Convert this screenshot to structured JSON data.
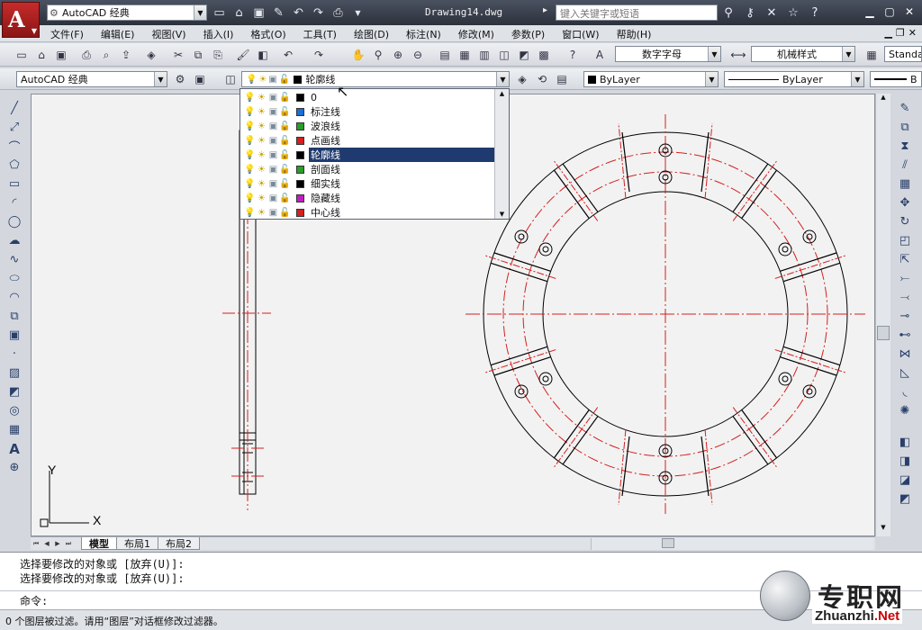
{
  "titlebar": {
    "logo_letter": "A",
    "workspace": "AutoCAD 经典",
    "document": "Drawing14.dwg",
    "search_placeholder": "键入关键字或短语"
  },
  "menu": [
    "文件(F)",
    "编辑(E)",
    "视图(V)",
    "插入(I)",
    "格式(O)",
    "工具(T)",
    "绘图(D)",
    "标注(N)",
    "修改(M)",
    "参数(P)",
    "窗口(W)",
    "帮助(H)"
  ],
  "styles": {
    "text_style": "数字字母",
    "dim_style": "机械样式",
    "table_style": "Standa"
  },
  "workspace_combo": "AutoCAD 经典",
  "layer": {
    "current": "轮廓线",
    "list": [
      {
        "name": "0",
        "color": "#000000"
      },
      {
        "name": "标注线",
        "color": "#1a6fd8"
      },
      {
        "name": "波浪线",
        "color": "#2a9d2a"
      },
      {
        "name": "点画线",
        "color": "#d42020"
      },
      {
        "name": "轮廓线",
        "color": "#000000",
        "selected": true
      },
      {
        "name": "剖面线",
        "color": "#2a9d2a"
      },
      {
        "name": "细实线",
        "color": "#000000"
      },
      {
        "name": "隐藏线",
        "color": "#c21fc2"
      },
      {
        "name": "中心线",
        "color": "#d42020"
      }
    ]
  },
  "properties": {
    "color": "ByLayer",
    "linetype": "ByLayer",
    "lineweight": "B"
  },
  "layout_tabs": [
    "模型",
    "布局1",
    "布局2"
  ],
  "ucs": {
    "x": "X",
    "y": "Y"
  },
  "command": {
    "history": [
      "选择要修改的对象或 [放弃(U)]:",
      "选择要修改的对象或 [放弃(U)]:"
    ],
    "prompt": "命令:"
  },
  "status": "0 个图层被过滤。请用“图层”对话框修改过滤器。",
  "watermark": {
    "text": "专职网",
    "url_a": "Zhuanzhi",
    "url_b": ".Net"
  },
  "colors": {
    "red_line": "#d42020",
    "selection": "#1f3a6e"
  }
}
